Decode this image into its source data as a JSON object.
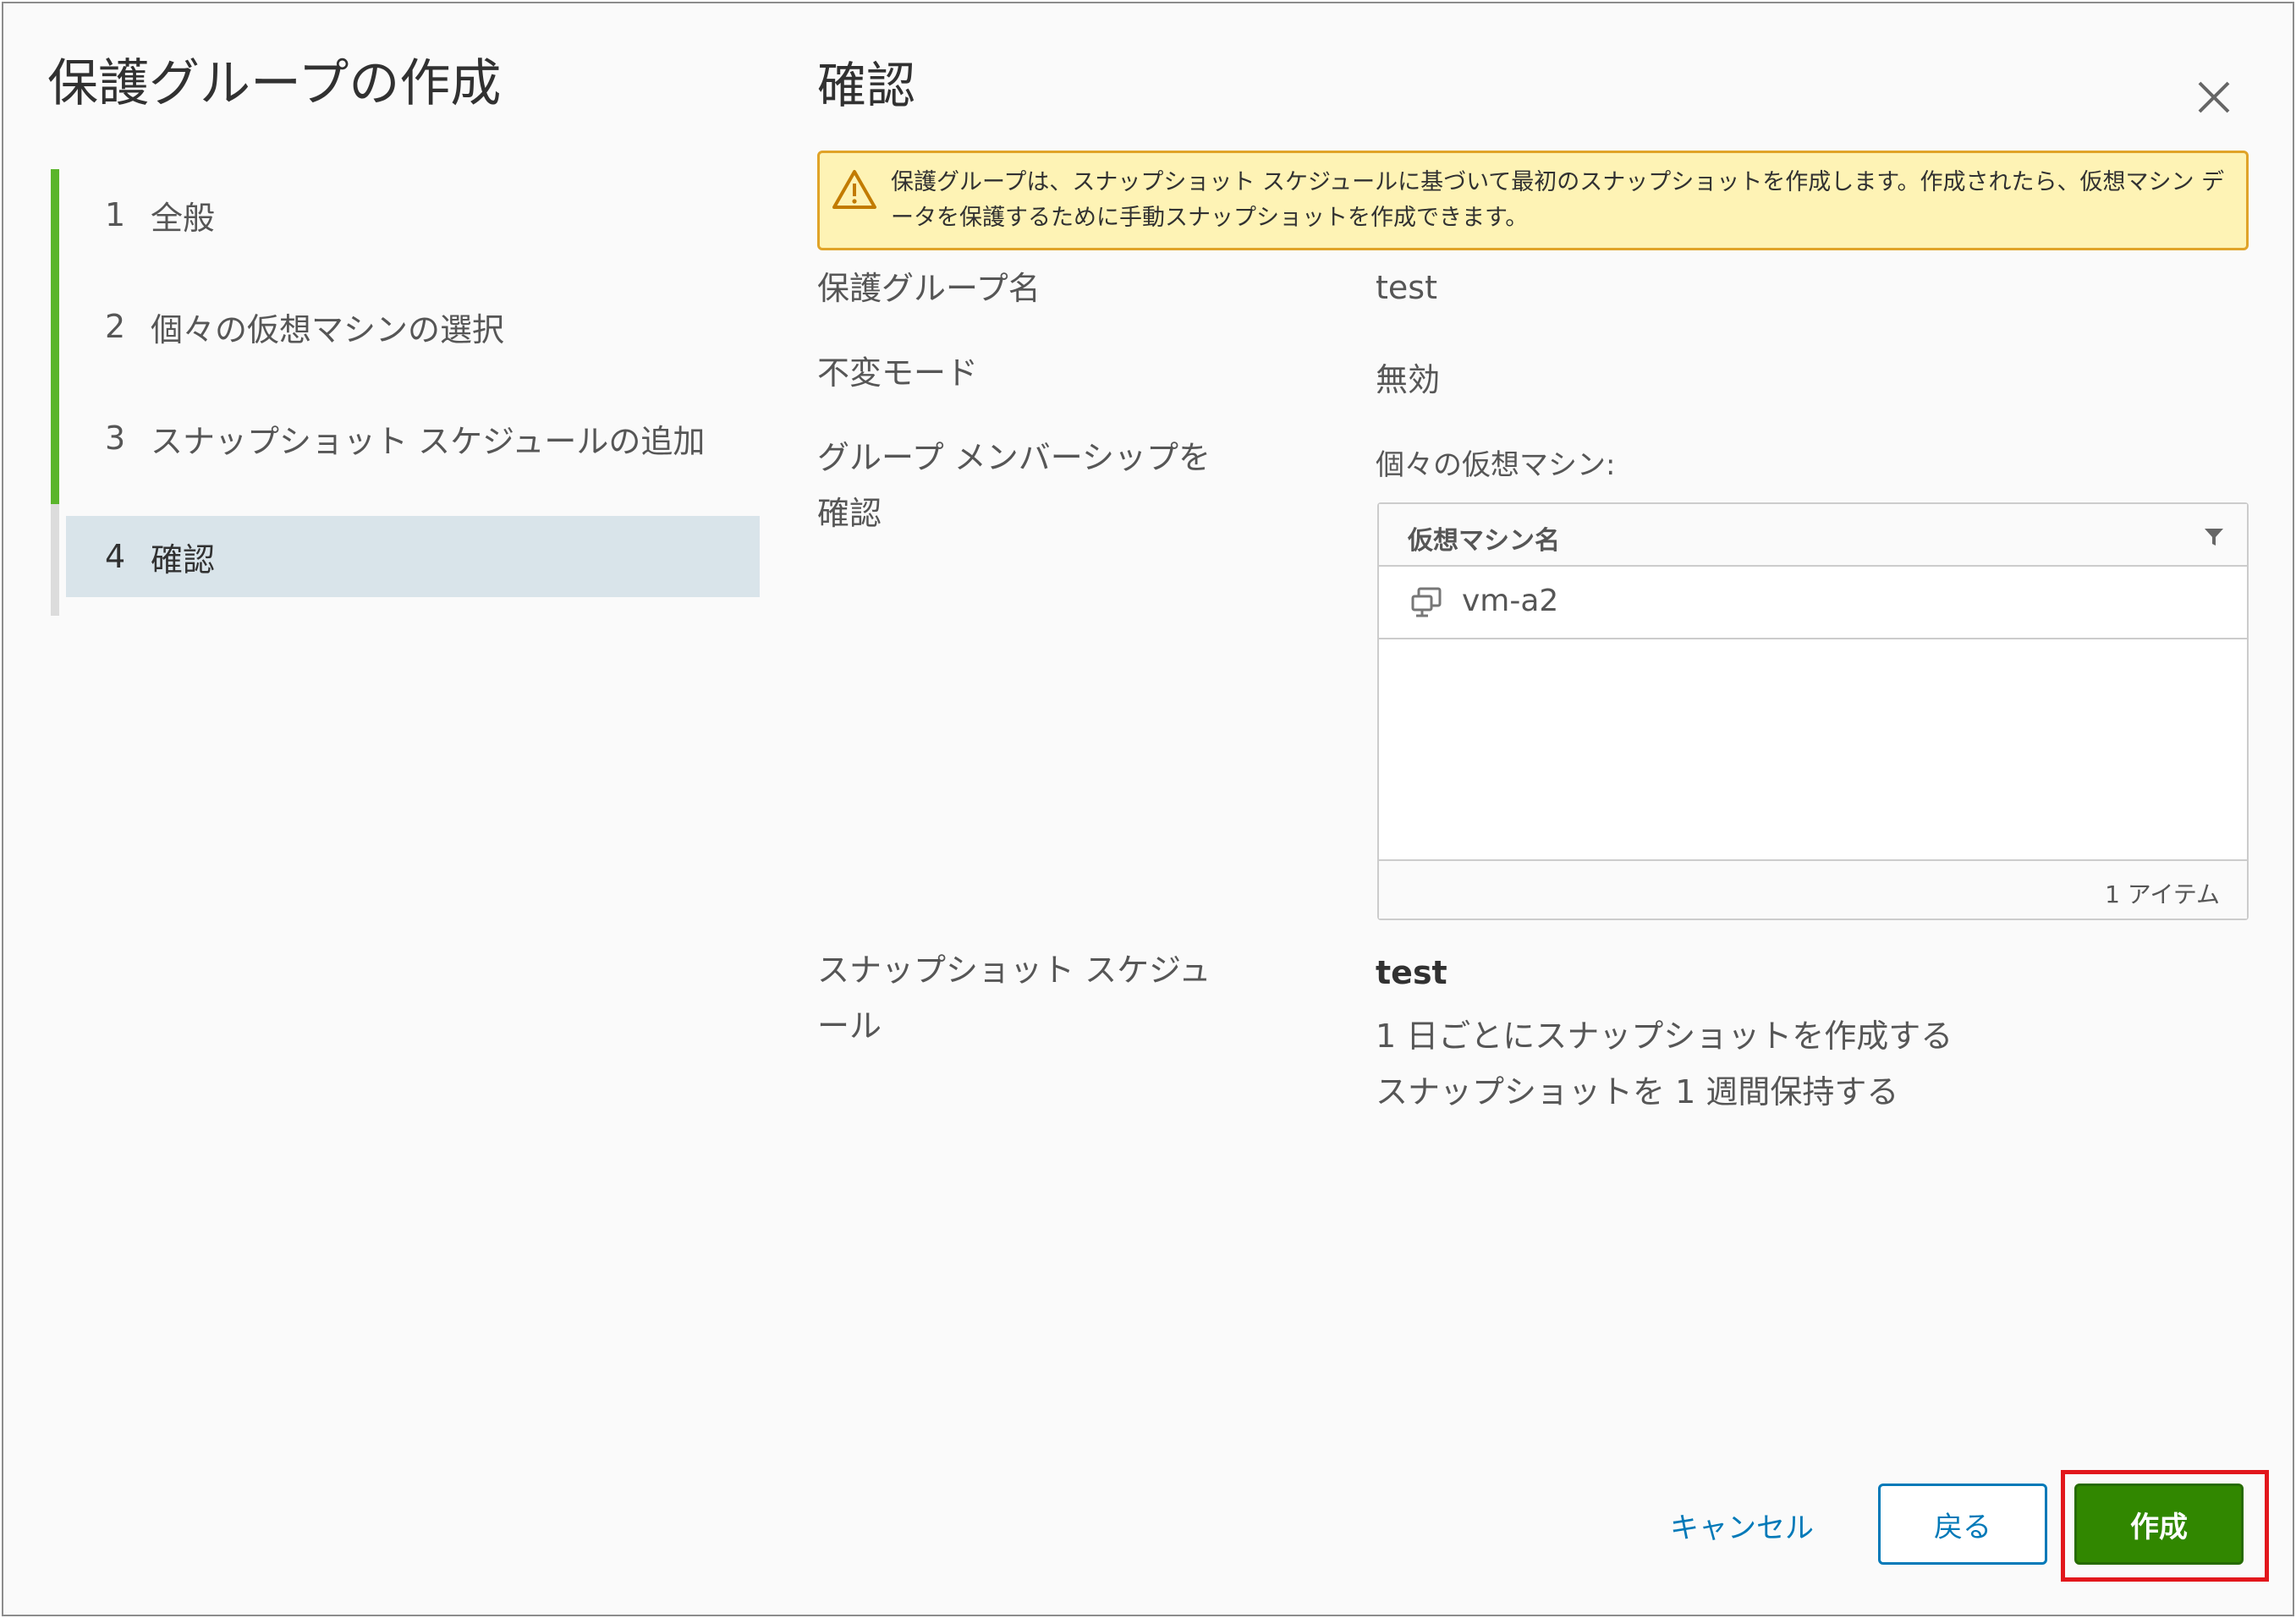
{
  "wizard": {
    "title": "保護グループの作成",
    "steps": [
      {
        "num": "1",
        "label": "全般"
      },
      {
        "num": "2",
        "label": "個々の仮想マシンの選択"
      },
      {
        "num": "3",
        "label": "スナップショット スケジュールの追加"
      },
      {
        "num": "4",
        "label": "確認"
      }
    ]
  },
  "content": {
    "title": "確認",
    "warning": "保護グループは、スナップショット スケジュールに基づいて最初のスナップショットを作成します。作成されたら、仮想マシン データを保護するために手動スナップショットを作成できます。",
    "fields": {
      "group_name_label": "保護グループ名",
      "group_name_value": "test",
      "immutable_label": "不変モード",
      "immutable_value": "無効",
      "membership_label": "グループ メンバーシップを確認",
      "membership_sublabel": "個々の仮想マシン:",
      "schedule_label": "スナップショット スケジュール",
      "schedule_name": "test",
      "schedule_frequency": "1 日ごとにスナップショットを作成する",
      "schedule_retention": "スナップショットを 1 週間保持する"
    },
    "grid": {
      "column_header": "仮想マシン名",
      "rows": [
        {
          "name": "vm-a2"
        }
      ],
      "footer_count": "1 アイテム"
    }
  },
  "footer": {
    "cancel_label": "キャンセル",
    "back_label": "戻る",
    "create_label": "作成"
  },
  "colors": {
    "step_done": "#5ab52b",
    "step_active_bg": "#d9e4ea",
    "link_blue": "#0079b8",
    "create_green": "#318700",
    "warning_bg": "#fef3b5",
    "warning_border": "#e0a328",
    "highlight_red": "#e2171c"
  }
}
